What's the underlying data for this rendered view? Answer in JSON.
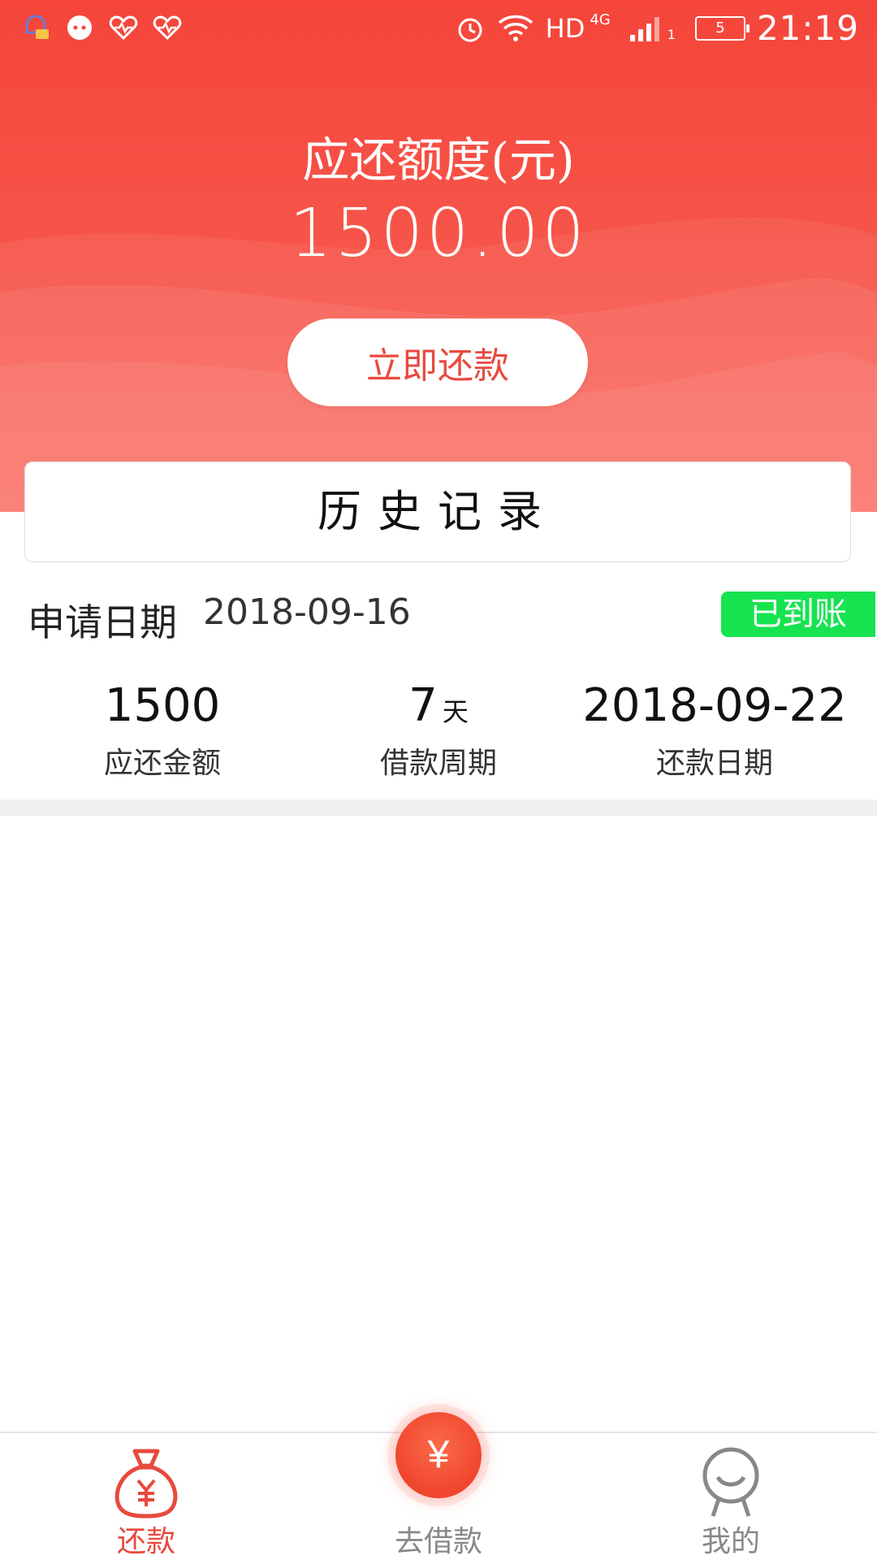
{
  "status_bar": {
    "network_type": "HD",
    "network_gen": "4G",
    "sim_slot": "1",
    "battery_level": "5",
    "time": "21:19",
    "icons": [
      "notification-app-icon",
      "chat-icon",
      "heart-rate-icon",
      "heart-rate-icon",
      "alarm-icon",
      "wifi-icon",
      "signal-icon",
      "battery-icon"
    ]
  },
  "hero": {
    "label": "应还额度(元)",
    "amount": "1500.00",
    "repay_button": "立即还款"
  },
  "history": {
    "title": "历史记录"
  },
  "record": {
    "date_label": "申请日期",
    "date_value": "2018-09-16",
    "status": "已到账",
    "amount_value": "1500",
    "amount_label": "应还金额",
    "period_value": "7",
    "period_unit": "天",
    "period_label": "借款周期",
    "due_value": "2018-09-22",
    "due_label": "还款日期"
  },
  "bottom_nav": {
    "items": [
      {
        "label": "还款",
        "icon": "money-bag-icon",
        "active": true
      },
      {
        "label": "去借款",
        "icon": "yen-coin-icon",
        "active": false
      },
      {
        "label": "我的",
        "icon": "user-icon",
        "active": false
      }
    ],
    "fab_symbol": "¥"
  },
  "colors": {
    "brand_red": "#f5453a",
    "accent_red_text": "#e84a3e",
    "status_green": "#17e351",
    "inactive_gray": "#888888"
  }
}
